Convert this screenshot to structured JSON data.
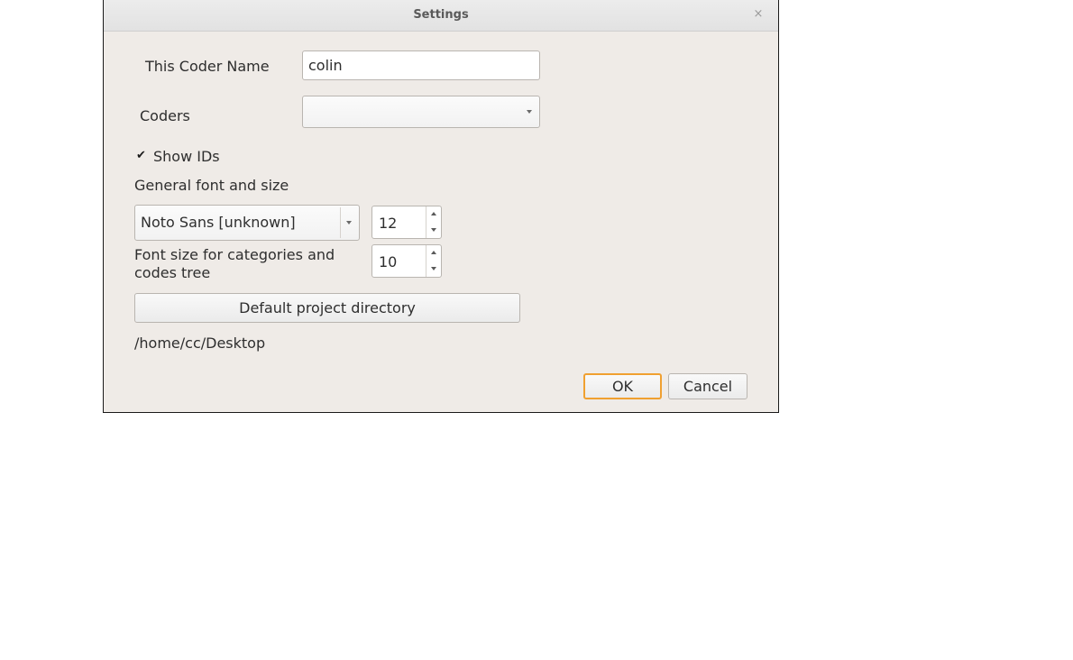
{
  "window": {
    "title": "Settings",
    "close_glyph": "×"
  },
  "coder_name": {
    "label": "This Coder Name",
    "value": "colin"
  },
  "coders": {
    "label": "Coders",
    "selected": ""
  },
  "show_ids": {
    "label": "Show IDs",
    "checked": true,
    "check_glyph": "✔"
  },
  "general_font": {
    "label": "General font and size",
    "font": "Noto Sans [unknown]",
    "size": "12"
  },
  "tree_font": {
    "label_line1": "Font size for categories and",
    "label_line2": "codes tree",
    "size": "10"
  },
  "project_dir": {
    "button_label": "Default project directory",
    "path": "/home/cc/Desktop"
  },
  "footer": {
    "ok_label": "OK",
    "cancel_label": "Cancel"
  },
  "colors": {
    "dialog_bg": "#efebe7",
    "default_button_border": "#f0a030"
  },
  "icons": {
    "close": "close-icon",
    "combo_arrow": "chevron-down-icon",
    "spin_up": "chevron-up-icon",
    "spin_down": "chevron-down-icon",
    "check": "checkmark-icon"
  }
}
